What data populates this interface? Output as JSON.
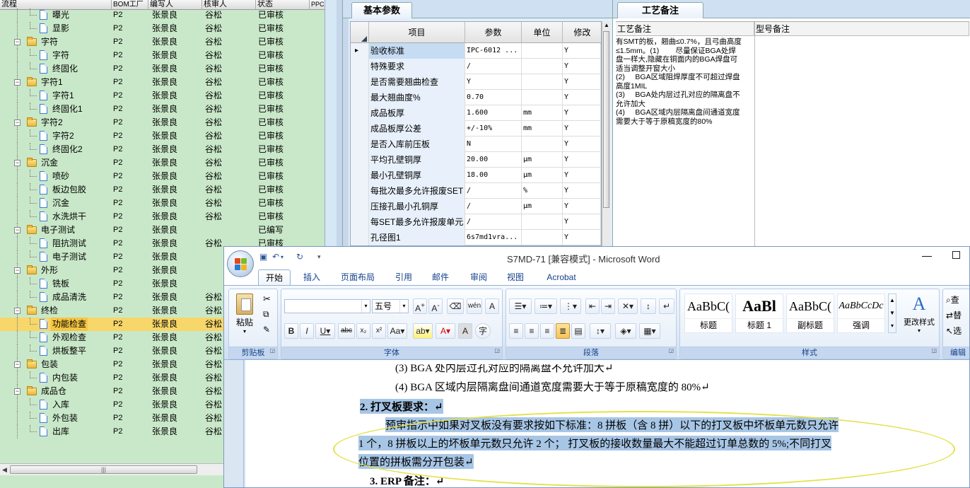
{
  "tree": {
    "columns": [
      "流程",
      "BOM工厂",
      "编写人",
      "核审人",
      "状态",
      "PPC"
    ],
    "rows": [
      {
        "name": "曝光",
        "level": 2,
        "kind": "doc",
        "bom": "P2",
        "writer": "张景良",
        "reviewer": "谷松",
        "status": "已审核"
      },
      {
        "name": "显影",
        "level": 2,
        "kind": "doc",
        "bom": "P2",
        "writer": "张景良",
        "reviewer": "谷松",
        "status": "已审核"
      },
      {
        "name": "字符",
        "level": 1,
        "kind": "folder",
        "bom": "P2",
        "writer": "张景良",
        "reviewer": "谷松",
        "status": "已审核"
      },
      {
        "name": "字符",
        "level": 2,
        "kind": "doc",
        "bom": "P2",
        "writer": "张景良",
        "reviewer": "谷松",
        "status": "已审核"
      },
      {
        "name": "终固化",
        "level": 2,
        "kind": "doc",
        "bom": "P2",
        "writer": "张景良",
        "reviewer": "谷松",
        "status": "已审核"
      },
      {
        "name": "字符1",
        "level": 1,
        "kind": "folder",
        "bom": "P2",
        "writer": "张景良",
        "reviewer": "谷松",
        "status": "已审核"
      },
      {
        "name": "字符1",
        "level": 2,
        "kind": "doc",
        "bom": "P2",
        "writer": "张景良",
        "reviewer": "谷松",
        "status": "已审核"
      },
      {
        "name": "终固化1",
        "level": 2,
        "kind": "doc",
        "bom": "P2",
        "writer": "张景良",
        "reviewer": "谷松",
        "status": "已审核"
      },
      {
        "name": "字符2",
        "level": 1,
        "kind": "folder",
        "bom": "P2",
        "writer": "张景良",
        "reviewer": "谷松",
        "status": "已审核"
      },
      {
        "name": "字符2",
        "level": 2,
        "kind": "doc",
        "bom": "P2",
        "writer": "张景良",
        "reviewer": "谷松",
        "status": "已审核"
      },
      {
        "name": "终固化2",
        "level": 2,
        "kind": "doc",
        "bom": "P2",
        "writer": "张景良",
        "reviewer": "谷松",
        "status": "已审核"
      },
      {
        "name": "沉金",
        "level": 1,
        "kind": "folder",
        "bom": "P2",
        "writer": "张景良",
        "reviewer": "谷松",
        "status": "已审核"
      },
      {
        "name": "喷砂",
        "level": 2,
        "kind": "doc",
        "bom": "P2",
        "writer": "张景良",
        "reviewer": "谷松",
        "status": "已审核"
      },
      {
        "name": "板边包胶",
        "level": 2,
        "kind": "doc",
        "bom": "P2",
        "writer": "张景良",
        "reviewer": "谷松",
        "status": "已审核"
      },
      {
        "name": "沉金",
        "level": 2,
        "kind": "doc",
        "bom": "P2",
        "writer": "张景良",
        "reviewer": "谷松",
        "status": "已审核"
      },
      {
        "name": "水洗烘干",
        "level": 2,
        "kind": "doc",
        "bom": "P2",
        "writer": "张景良",
        "reviewer": "谷松",
        "status": "已审核"
      },
      {
        "name": "电子测试",
        "level": 1,
        "kind": "folder",
        "bom": "P2",
        "writer": "张景良",
        "reviewer": "",
        "status": "已编写"
      },
      {
        "name": "阻抗测试",
        "level": 2,
        "kind": "doc",
        "bom": "P2",
        "writer": "张景良",
        "reviewer": "谷松",
        "status": "已审核"
      },
      {
        "name": "电子测试",
        "level": 2,
        "kind": "doc",
        "bom": "P2",
        "writer": "张景良",
        "reviewer": "",
        "status": "已编写"
      },
      {
        "name": "外形",
        "level": 1,
        "kind": "folder",
        "bom": "P2",
        "writer": "张景良",
        "reviewer": "",
        "status": "已编写"
      },
      {
        "name": "铣板",
        "level": 2,
        "kind": "doc",
        "bom": "P2",
        "writer": "张景良",
        "reviewer": "",
        "status": "已编写"
      },
      {
        "name": "成品清洗",
        "level": 2,
        "kind": "doc",
        "bom": "P2",
        "writer": "张景良",
        "reviewer": "谷松",
        "status": "已审核"
      },
      {
        "name": "终检",
        "level": 1,
        "kind": "folder",
        "bom": "P2",
        "writer": "张景良",
        "reviewer": "谷松",
        "status": "已审核"
      },
      {
        "name": "功能检查",
        "level": 2,
        "kind": "doc",
        "bom": "P2",
        "writer": "张景良",
        "reviewer": "谷松",
        "status": "已审核",
        "selected": true
      },
      {
        "name": "外观检查",
        "level": 2,
        "kind": "doc",
        "bom": "P2",
        "writer": "张景良",
        "reviewer": "谷松",
        "status": "已审核"
      },
      {
        "name": "烘板整平",
        "level": 2,
        "kind": "doc",
        "bom": "P2",
        "writer": "张景良",
        "reviewer": "谷松",
        "status": "已审核"
      },
      {
        "name": "包装",
        "level": 1,
        "kind": "folder",
        "bom": "P2",
        "writer": "张景良",
        "reviewer": "谷松",
        "status": "已审核"
      },
      {
        "name": "内包装",
        "level": 2,
        "kind": "doc",
        "bom": "P2",
        "writer": "张景良",
        "reviewer": "谷松",
        "status": "已审核"
      },
      {
        "name": "成品仓",
        "level": 1,
        "kind": "folder",
        "bom": "P2",
        "writer": "张景良",
        "reviewer": "谷松",
        "status": "已审核"
      },
      {
        "name": "入库",
        "level": 2,
        "kind": "doc",
        "bom": "P2",
        "writer": "张景良",
        "reviewer": "谷松",
        "status": "已审核"
      },
      {
        "name": "外包装",
        "level": 2,
        "kind": "doc",
        "bom": "P2",
        "writer": "张景良",
        "reviewer": "谷松",
        "status": "已审核"
      },
      {
        "name": "出库",
        "level": 2,
        "kind": "doc",
        "bom": "P2",
        "writer": "张景良",
        "reviewer": "谷松",
        "status": "已审核"
      }
    ]
  },
  "params": {
    "tab": "基本参数",
    "columns": {
      "item": "项目",
      "value": "参数",
      "unit": "单位",
      "mod": "修改"
    },
    "rows": [
      {
        "item": "验收标准",
        "value": "IPC-6012 ...",
        "unit": "",
        "mod": "Y",
        "selected": true
      },
      {
        "item": "特殊要求",
        "value": "/",
        "unit": "",
        "mod": "Y"
      },
      {
        "item": "是否需要翘曲检查",
        "value": "Y",
        "unit": "",
        "mod": "Y"
      },
      {
        "item": "最大翘曲度%",
        "value": "0.70",
        "unit": "",
        "mod": "Y"
      },
      {
        "item": "成品板厚",
        "value": "1.600",
        "unit": "mm",
        "mod": "Y"
      },
      {
        "item": "成品板厚公差",
        "value": "+/-10%",
        "unit": "mm",
        "mod": "Y"
      },
      {
        "item": "是否入库前压板",
        "value": "N",
        "unit": "",
        "mod": "Y"
      },
      {
        "item": "平均孔壁铜厚",
        "value": "20.00",
        "unit": "μm",
        "mod": "Y"
      },
      {
        "item": "最小孔壁铜厚",
        "value": "18.00",
        "unit": "μm",
        "mod": "Y"
      },
      {
        "item": "每批次最多允许报废SET",
        "value": "/",
        "unit": "%",
        "mod": "Y"
      },
      {
        "item": "压接孔最小孔铜厚",
        "value": "/",
        "unit": "μm",
        "mod": "Y"
      },
      {
        "item": "每SET最多允许报废单元",
        "value": "/",
        "unit": "",
        "mod": "Y"
      },
      {
        "item": "孔径图1",
        "value": "6s7md1vra...",
        "unit": "",
        "mod": "Y"
      }
    ]
  },
  "notes": {
    "tab": "工艺备注",
    "col1": "工艺备注",
    "col2": "型号备注",
    "text": "有SMT的板，翘曲≤0.7%，且弓曲高度≤1.5mm。(1)        尽量保证BGA处焊盘一样大,隐藏在铜面内的BGA焊盘可适当调整开窗大小\n(2)     BGA区域阻焊厚度不可超过焊盘高度1MIL\n(3)     BGA处内层过孔对应的隔离盘不允许加大\n(4)     BGA区域内层隔离盘间通道宽度需要大于等于原稿宽度的80%"
  },
  "word": {
    "title": "S7MD-71 [兼容模式] - Microsoft Word",
    "tabs": [
      "开始",
      "插入",
      "页面布局",
      "引用",
      "邮件",
      "审阅",
      "视图",
      "Acrobat"
    ],
    "font_size": "五号",
    "groups": {
      "clipboard": "剪贴板",
      "font": "字体",
      "paragraph": "段落",
      "styles": "样式",
      "editing": "编辑"
    },
    "paste_label": "粘贴",
    "change_styles": "更改样式",
    "styles": [
      {
        "sample": "AaBbC(",
        "name": "标题"
      },
      {
        "sample": "AaBl",
        "name": "标题 1"
      },
      {
        "sample": "AaBbC(",
        "name": "副标题"
      },
      {
        "sample": "AaBbCcDc",
        "name": "强调"
      }
    ],
    "edit_buttons": [
      "查",
      "替",
      "选"
    ],
    "doc": {
      "line1": "(3)  BGA 处内层过孔对应的隔离盘不允许加大↵",
      "line2": "(4)  BGA 区域内层隔离盘间通道宽度需要大于等于原稿宽度的 80%↵",
      "heading2": "2. 打叉板要求：↵",
      "para_a": "预审指示中如果对叉板没有要求按如下标准：8 拼板（含 8 拼）以下的打叉板中坏板单元数只允许",
      "para_b": "1 个，8 拼板以上的坏板单元数只允许 2 个；  打叉板的接收数量最大不能超过订单总数的 5%;不同打叉",
      "para_c": "位置的拼板需分开包装↵",
      "heading3": "3. ERP 备注：↵"
    }
  }
}
